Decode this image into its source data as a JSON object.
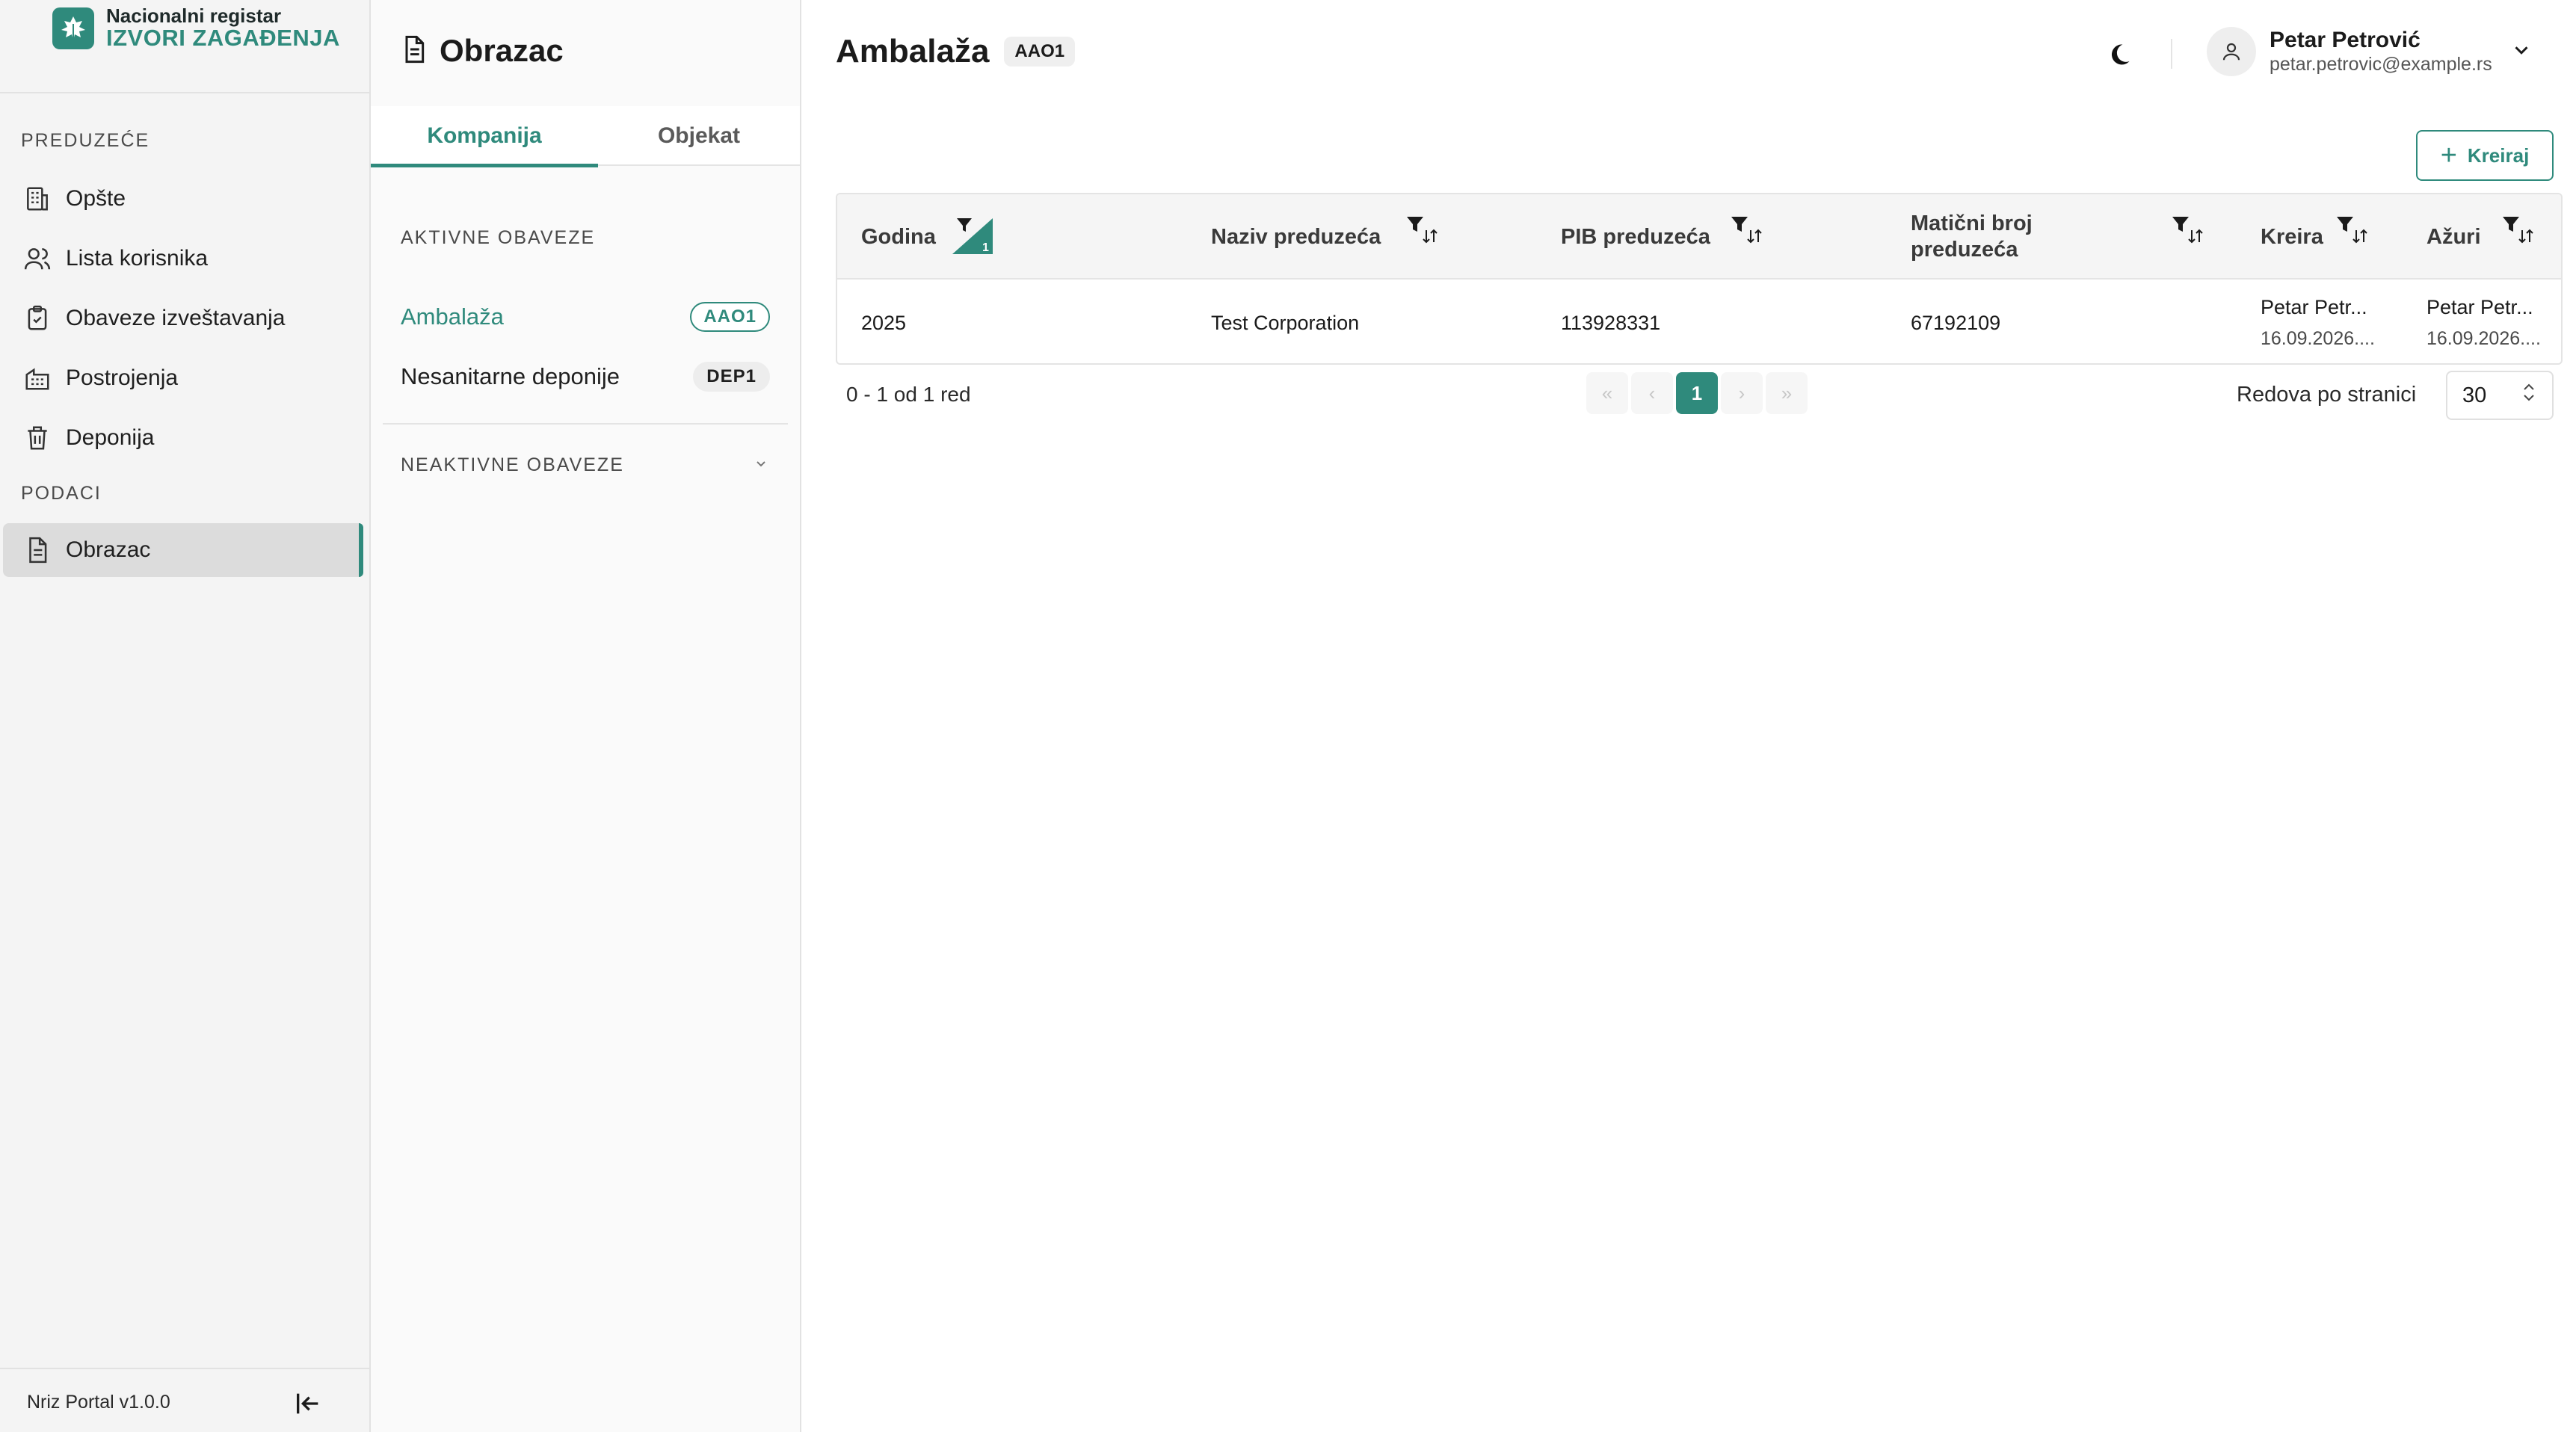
{
  "brand": {
    "line1": "Nacionalni registar",
    "line2": "IZVORI ZAGAĐENJA"
  },
  "sidebar": {
    "section1": "PREDUZEĆE",
    "items": [
      {
        "label": "Opšte",
        "icon": "building-icon"
      },
      {
        "label": "Lista korisnika",
        "icon": "users-icon"
      },
      {
        "label": "Obaveze izveštavanja",
        "icon": "clipboard-check-icon"
      },
      {
        "label": "Postrojenja",
        "icon": "factory-icon"
      },
      {
        "label": "Deponija",
        "icon": "trash-icon"
      }
    ],
    "section2": "PODACI",
    "data_items": [
      {
        "label": "Obrazac",
        "icon": "document-icon",
        "active": true
      }
    ],
    "version": "Nriz Portal v1.0.0"
  },
  "panel": {
    "title": "Obrazac",
    "tabs": [
      {
        "label": "Kompanija",
        "active": true
      },
      {
        "label": "Objekat",
        "active": false
      }
    ],
    "active_section": "AKTIVNE OBAVEZE",
    "obligations": [
      {
        "label": "Ambalaža",
        "code": "AAO1",
        "active": true
      },
      {
        "label": "Nesanitarne deponije",
        "code": "DEP1",
        "active": false
      }
    ],
    "inactive_section": "NEAKTIVNE OBAVEZE"
  },
  "header": {
    "title": "Ambalaža",
    "badge": "AAO1",
    "user": {
      "name": "Petar Petrović",
      "email": "petar.petrovic@example.rs"
    }
  },
  "toolbar": {
    "create_label": "Kreiraj"
  },
  "table": {
    "columns": [
      {
        "label": "Godina",
        "filter_count": "1"
      },
      {
        "label": "Naziv preduzeća"
      },
      {
        "label": "PIB preduzeća"
      },
      {
        "label": "Matični broj preduzeća"
      },
      {
        "label": "Kreira"
      },
      {
        "label": "Ažuri"
      }
    ],
    "rows": [
      {
        "year": "2025",
        "company": "Test Corporation",
        "pib": "113928331",
        "mb": "67192109",
        "created_by": "Petar Petr...",
        "created_at": "16.09.2026....",
        "updated_by": "Petar Petr...",
        "updated_at": "16.09.2026...."
      }
    ]
  },
  "pagination": {
    "range": "0 - 1 od 1 red",
    "current_page": "1",
    "rows_label": "Redova po stranici",
    "rows_value": "30"
  },
  "colors": {
    "accent": "#2f8a7c",
    "sidebar_bg": "#f4f4f4",
    "active_item_bg": "#dcdcdc"
  }
}
